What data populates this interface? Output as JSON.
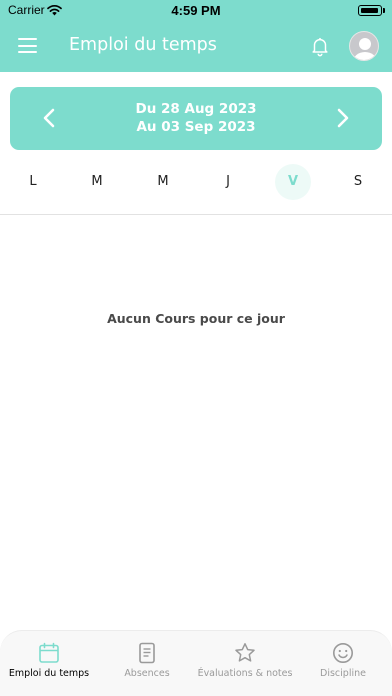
{
  "status_bar": {
    "carrier": "Carrier",
    "time": "4:59 PM"
  },
  "header": {
    "title": "Emploi du temps"
  },
  "week": {
    "start": "Du 28 Aug 2023",
    "end": "Au 03 Sep 2023"
  },
  "days": [
    {
      "label": "L",
      "selected": false
    },
    {
      "label": "M",
      "selected": false
    },
    {
      "label": "M",
      "selected": false
    },
    {
      "label": "J",
      "selected": false
    },
    {
      "label": "V",
      "selected": true
    },
    {
      "label": "S",
      "selected": false
    }
  ],
  "empty_message": "Aucun Cours pour ce jour",
  "tabs": [
    {
      "label": "Emploi du temps",
      "icon": "calendar-icon",
      "active": true
    },
    {
      "label": "Absences",
      "icon": "document-icon",
      "active": false
    },
    {
      "label": "Évaluations & notes",
      "icon": "star-icon",
      "active": false
    },
    {
      "label": "Discipline",
      "icon": "smiley-icon",
      "active": false
    }
  ],
  "colors": {
    "accent": "#7ddccd",
    "accent_light": "#edfaf7",
    "inactive": "#9a9a9a"
  }
}
